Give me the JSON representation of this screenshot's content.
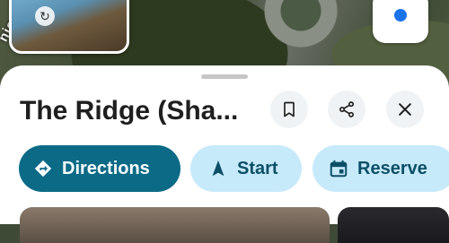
{
  "map": {
    "road_label": "nic",
    "location_button_icon": "my-location-icon"
  },
  "place": {
    "title": "The Ridge (Sha..."
  },
  "header_actions": {
    "save_icon": "bookmark-icon",
    "share_icon": "share-icon",
    "close_icon": "close-icon"
  },
  "actions": [
    {
      "label": "Directions",
      "icon": "directions-icon"
    },
    {
      "label": "Start",
      "icon": "navigation-arrow-icon"
    },
    {
      "label": "Reserve",
      "icon": "calendar-icon"
    }
  ],
  "colors": {
    "primary": "#0b6b87",
    "chip_secondary_bg": "#c7eafb",
    "chip_secondary_text": "#0b4f66",
    "location_dot": "#1a73e8"
  }
}
